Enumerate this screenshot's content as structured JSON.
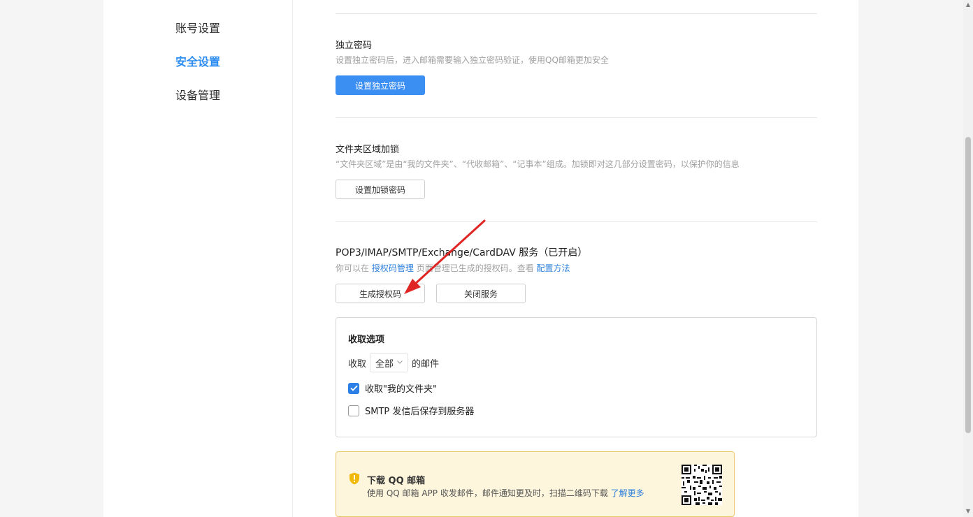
{
  "sidebar": {
    "items": [
      {
        "label": "账号设置",
        "active": false
      },
      {
        "label": "安全设置",
        "active": true
      },
      {
        "label": "设备管理",
        "active": false
      }
    ]
  },
  "independent_password": {
    "title": "独立密码",
    "desc": "设置独立密码后，进入邮箱需要输入独立密码验证，使用QQ邮箱更加安全",
    "button": "设置独立密码"
  },
  "folder_lock": {
    "title": "文件夹区域加锁",
    "desc": "“文件夹区域”是由“我的文件夹”、“代收邮箱”、“记事本”组成。加锁即对这几部分设置密码，以保护你的信息",
    "button": "设置加锁密码"
  },
  "service": {
    "title": "POP3/IMAP/SMTP/Exchange/CardDAV 服务（已开启）",
    "desc_prefix": "你可以在",
    "desc_link1": "授权码管理",
    "desc_middle": "页面管理已生成的授权码。查看",
    "desc_link2": "配置方法",
    "generate_button": "生成授权码",
    "close_button": "关闭服务"
  },
  "receive_options": {
    "title": "收取选项",
    "prefix": "收取",
    "select_value": "全部",
    "suffix": "的邮件",
    "option1": {
      "label": "收取\"我的文件夹\"",
      "checked": true
    },
    "option2": {
      "label": "SMTP 发信后保存到服务器",
      "checked": false
    }
  },
  "download_banner": {
    "title": "下载 QQ 邮箱",
    "desc": "使用 QQ 邮箱 APP 收发邮件，邮件通知更及时，扫描二维码下载",
    "link": "了解更多"
  },
  "colors": {
    "accent": "#2c8cf0",
    "primary_button": "#3b8ef2",
    "annotation_arrow": "#e02525",
    "banner_bg": "#fdf6dc",
    "banner_border": "#e9c86a",
    "shield_icon": "#f0b90b"
  }
}
